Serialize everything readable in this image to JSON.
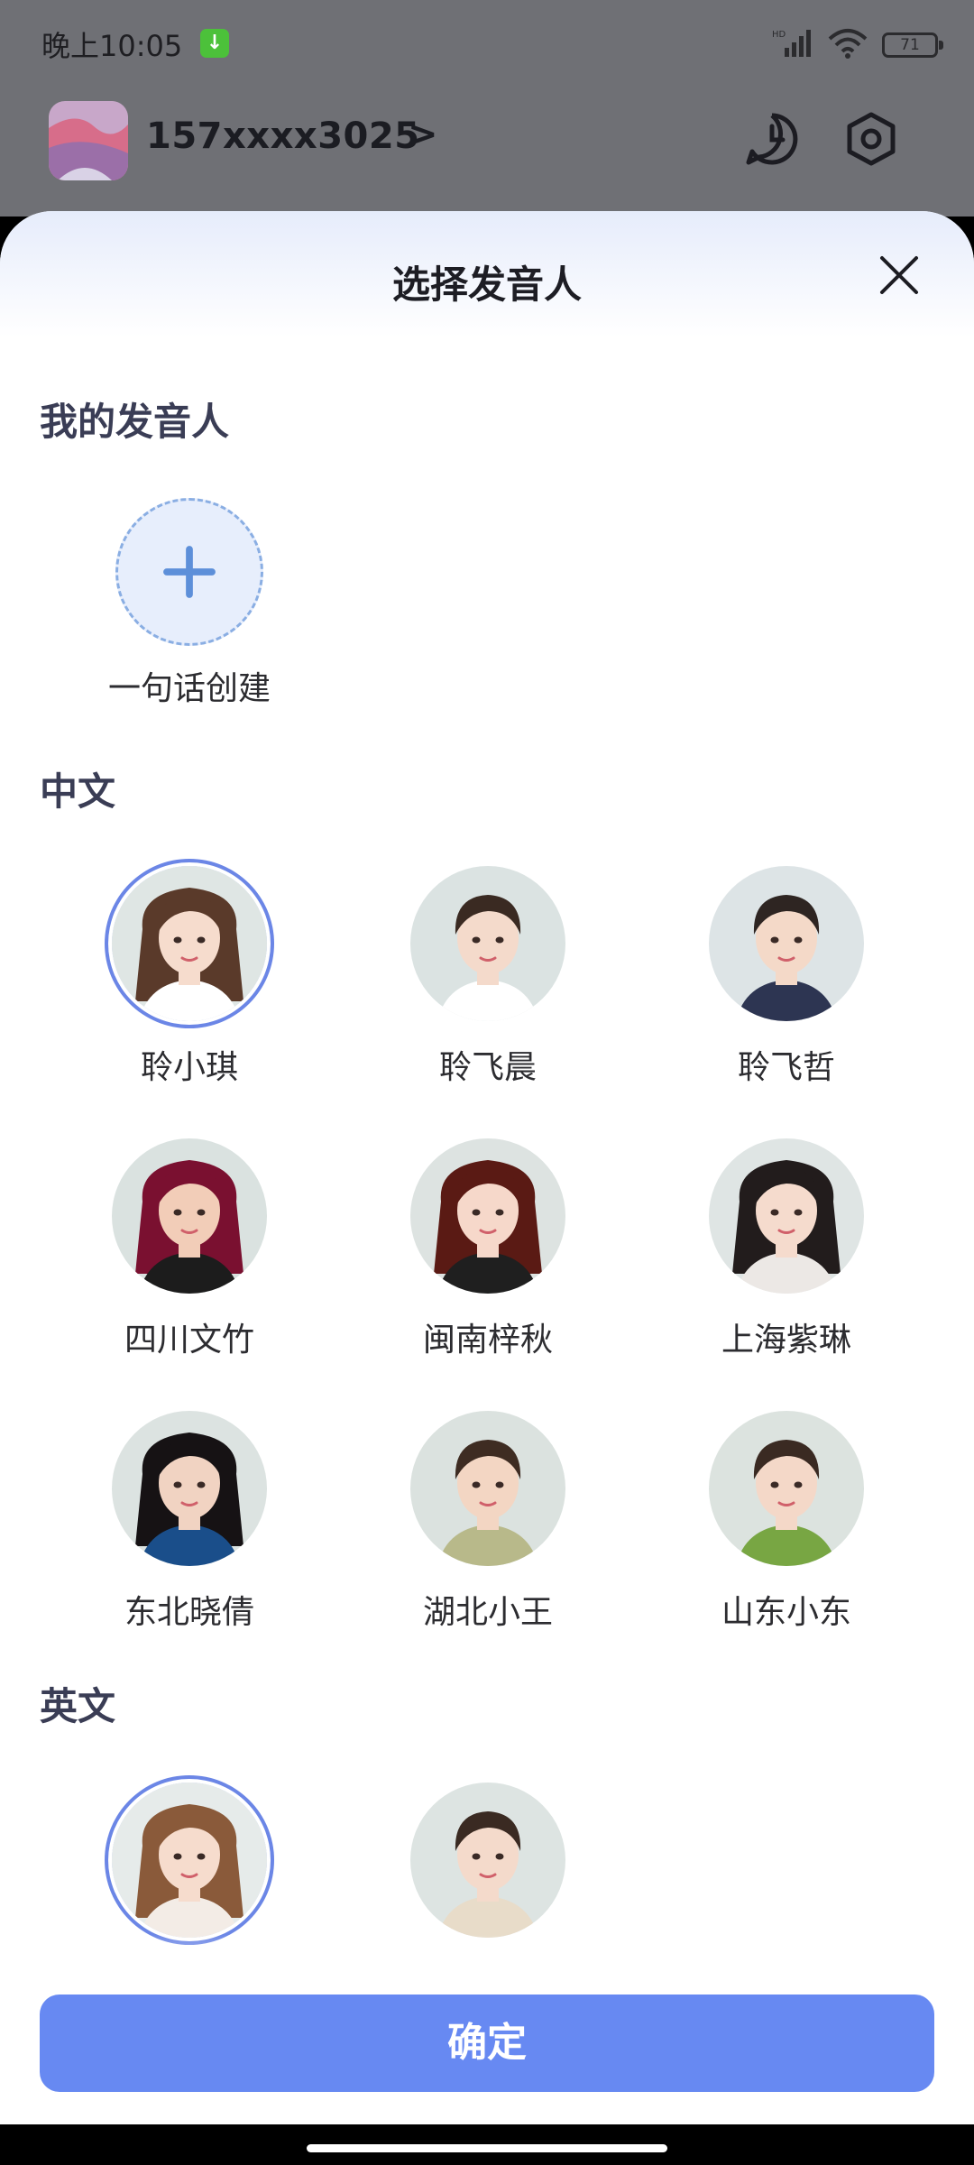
{
  "status_bar": {
    "time": "晚上10:05",
    "battery": "71",
    "network_label": "HD"
  },
  "user": {
    "phone": "157xxxx3025",
    "arrow": ">"
  },
  "sheet": {
    "title": "选择发音人"
  },
  "sections": {
    "mine": {
      "title": "我的发音人",
      "create_label": "一句话创建"
    },
    "chinese": {
      "title": "中文",
      "voices": [
        {
          "name": "聆小琪",
          "selected": true
        },
        {
          "name": "聆飞晨",
          "selected": false
        },
        {
          "name": "聆飞哲",
          "selected": false
        },
        {
          "name": "四川文竹",
          "selected": false
        },
        {
          "name": "闽南梓秋",
          "selected": false
        },
        {
          "name": "上海紫琳",
          "selected": false
        },
        {
          "name": "东北晓倩",
          "selected": false
        },
        {
          "name": "湖北小王",
          "selected": false
        },
        {
          "name": "山东小东",
          "selected": false
        }
      ]
    },
    "english": {
      "title": "英文",
      "voices": [
        {
          "name": "",
          "selected": true
        },
        {
          "name": "",
          "selected": false
        }
      ]
    }
  },
  "confirm_label": "确定",
  "colors": {
    "accent": "#6789f2",
    "selected_ring": "#6b86e6",
    "add_fill": "#e7eefc"
  }
}
